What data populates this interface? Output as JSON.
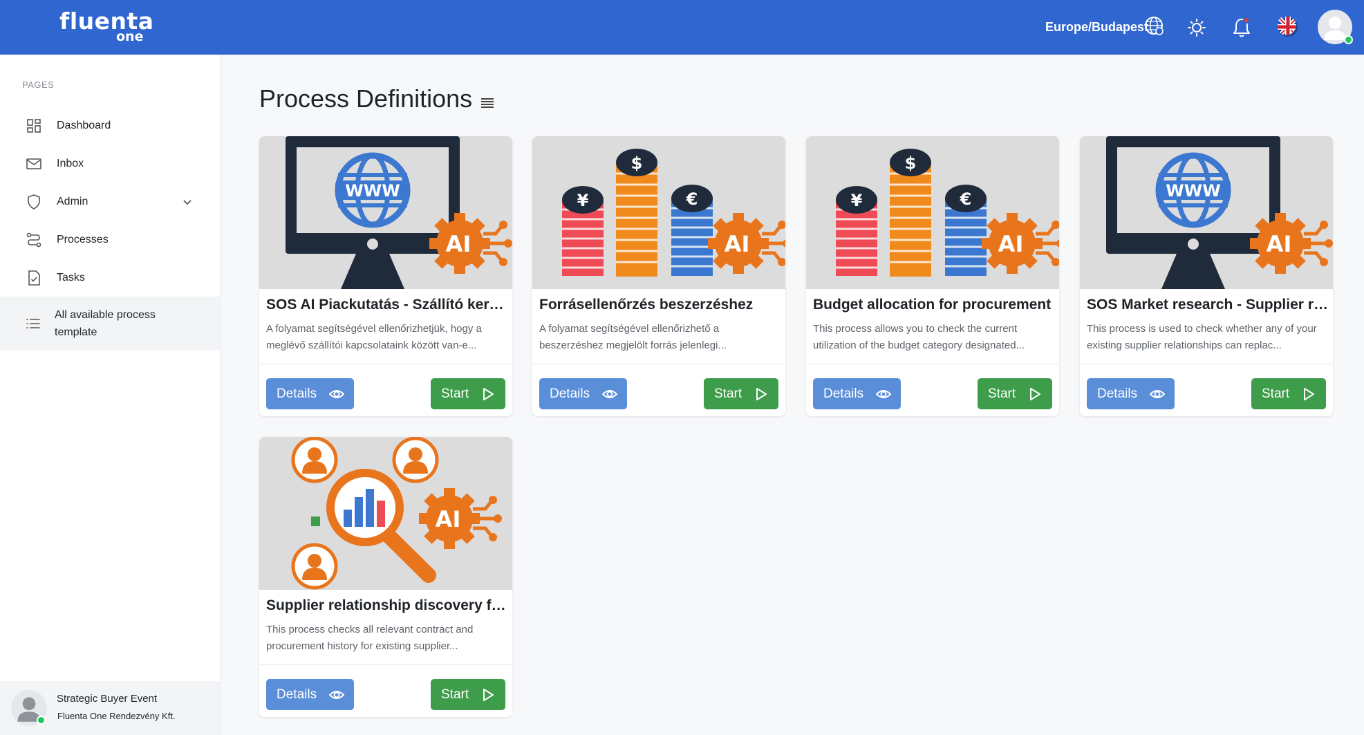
{
  "topbar": {
    "brand": "fluenta",
    "brand_sub": "one",
    "timezone": "Europe/Budapest",
    "icons": [
      "globe-icon",
      "sun-icon",
      "bell-icon",
      "uk-flag-icon",
      "user-avatar"
    ]
  },
  "sidebar": {
    "section_label": "PAGES",
    "items": [
      {
        "label": "Dashboard",
        "icon": "dashboard-icon"
      },
      {
        "label": "Inbox",
        "icon": "mail-icon"
      },
      {
        "label": "Admin",
        "icon": "shield-icon"
      },
      {
        "label": "Processes",
        "icon": "processes-icon"
      },
      {
        "label": "Tasks",
        "icon": "task-icon"
      },
      {
        "label": "All available process template",
        "icon": "list-icon"
      }
    ],
    "footer": {
      "name": "Strategic Buyer Event",
      "org": "Fluenta One Rendezvény Kft."
    }
  },
  "main": {
    "title": "Process Definitions",
    "cards": [
      {
        "title": "SOS AI Piackutatás - Szállító keresés",
        "description": "A folyamat segítségével ellenőrizhetjük, hogy a meglévő szállítói kapcsolataink között van-e...",
        "details_label": "Details",
        "start_label": "Start",
        "image": "monitor-www-ai"
      },
      {
        "title": "Forrásellenőrzés beszerzéshez",
        "description": "A folyamat segítségével ellenőrizhető a beszerzéshez megjelölt forrás jelenlegi...",
        "details_label": "Details",
        "start_label": "Start",
        "image": "coin-stacks-ai"
      },
      {
        "title": "Budget allocation for procurement",
        "description": "This process allows you to check the current utilization of the budget category designated...",
        "details_label": "Details",
        "start_label": "Start",
        "image": "coin-stacks-ai"
      },
      {
        "title": "SOS Market research - Supplier research",
        "description": "This process is used to check whether any of your existing supplier relationships can replac...",
        "details_label": "Details",
        "start_label": "Start",
        "image": "monitor-www-ai"
      },
      {
        "title": "Supplier relationship discovery for procurement",
        "description": "This process checks all relevant contract and procurement history for existing supplier...",
        "details_label": "Details",
        "start_label": "Start",
        "image": "magnifier-people-ai"
      }
    ]
  },
  "colors": {
    "topbar": "#2f66d0",
    "details_button": "#5b8ed8",
    "start_button": "#3e9d4a",
    "ai_orange": "#e8741c"
  }
}
